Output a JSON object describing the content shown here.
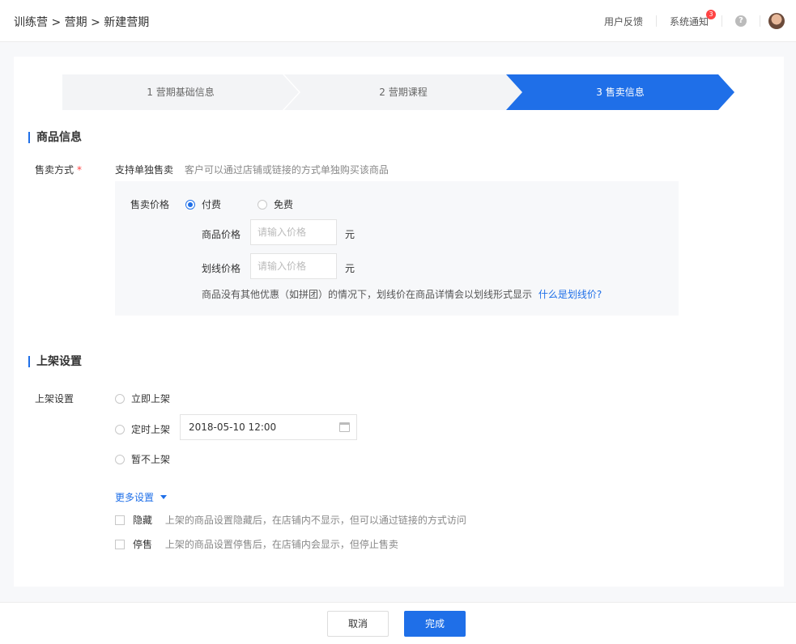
{
  "breadcrumb": "训练营 > 营期 > 新建营期",
  "header": {
    "feedback": "用户反馈",
    "notifications": "系统通知",
    "notification_count": "3",
    "help": "?"
  },
  "steps": [
    {
      "label": "1 营期基础信息",
      "active": false
    },
    {
      "label": "2 营期课程",
      "active": false
    },
    {
      "label": "3 售卖信息",
      "active": true
    }
  ],
  "product_section": {
    "title": "商品信息",
    "sale_mode_label": "售卖方式",
    "required_mark": "*",
    "sale_mode_value": "支持单独售卖",
    "sale_mode_hint": "客户可以通过店铺或链接的方式单独购买该商品",
    "price_label": "售卖价格",
    "paid_option": "付费",
    "free_option": "免费",
    "selected_option": "付费",
    "product_price_label": "商品价格",
    "product_price_placeholder": "请输入价格",
    "strike_price_label": "划线价格",
    "strike_price_placeholder": "请输入价格",
    "currency_unit": "元",
    "strike_hint": "商品没有其他优惠（如拼团）的情况下，划线价在商品详情会以划线形式显示",
    "strike_help_link": "什么是划线价?"
  },
  "listing_section": {
    "title": "上架设置",
    "label": "上架设置",
    "options": [
      "立即上架",
      "定时上架",
      "暂不上架"
    ],
    "scheduled_datetime": "2018-05-10  12:00",
    "more_settings": "更多设置",
    "hide_label": "隐藏",
    "hide_hint": "上架的商品设置隐藏后，在店铺内不显示，但可以通过链接的方式访问",
    "stop_label": "停售",
    "stop_hint": "上架的商品设置停售后，在店铺内会显示，但停止售卖"
  },
  "footer": {
    "cancel": "取消",
    "done": "完成"
  },
  "colors": {
    "accent": "#1f6fe8",
    "badge": "#ff4444"
  }
}
